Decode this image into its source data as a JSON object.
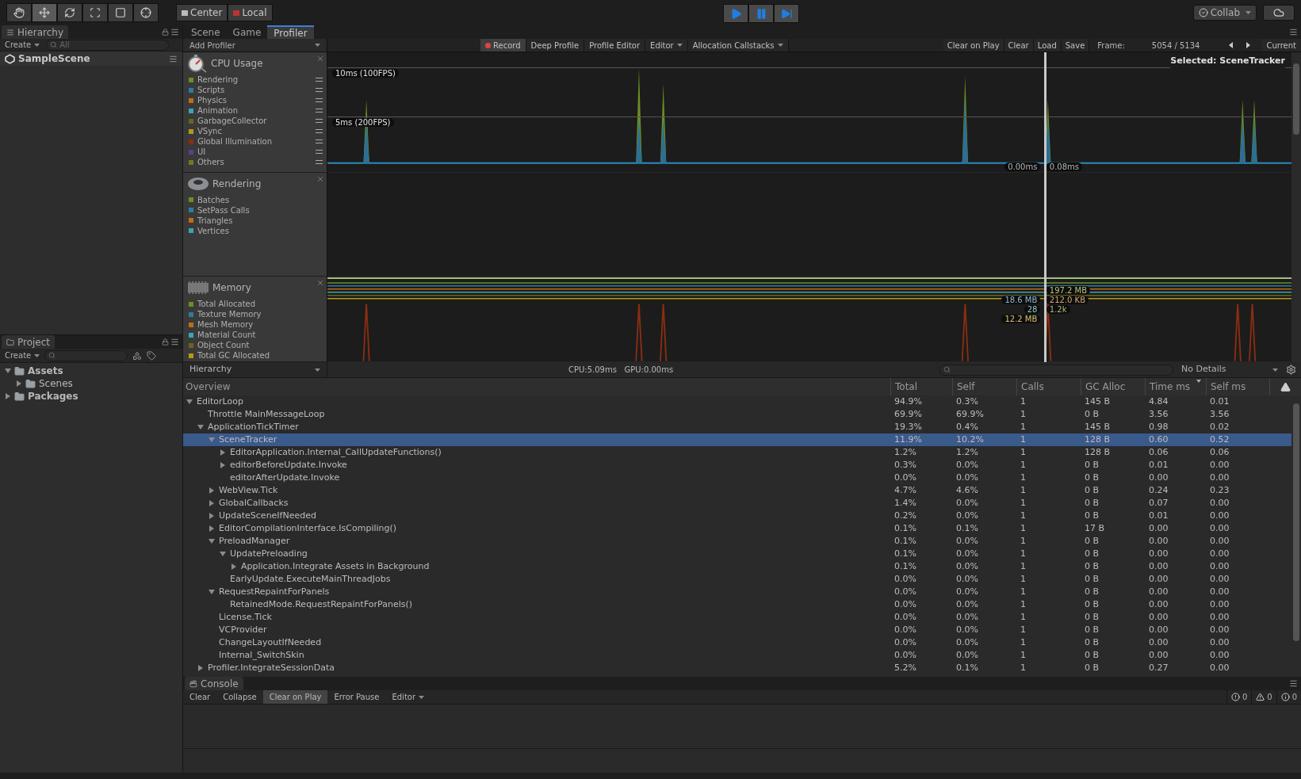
{
  "toolbar": {
    "tools": [
      {
        "kind": "hand",
        "selected": false
      },
      {
        "kind": "move",
        "selected": true
      },
      {
        "kind": "rotate",
        "selected": false
      },
      {
        "kind": "scale",
        "selected": false
      },
      {
        "kind": "rect",
        "selected": false
      },
      {
        "kind": "transform",
        "selected": false
      }
    ],
    "pivot": [
      "Center",
      "Local"
    ],
    "play": [
      {
        "kind": "play"
      },
      {
        "kind": "pause"
      },
      {
        "kind": "step"
      }
    ],
    "collab": "Collab"
  },
  "hierarchy": {
    "tab": "Hierarchy",
    "create": "Create",
    "search_placeholder": "All",
    "scene": "SampleScene"
  },
  "project": {
    "tab": "Project",
    "create": "Create",
    "tree": [
      {
        "name": "Assets",
        "kind": "branch",
        "expanded": true,
        "children": [
          {
            "name": "Scenes",
            "kind": "branch",
            "expanded": false
          }
        ]
      },
      {
        "name": "Packages",
        "kind": "branch",
        "expanded": false
      }
    ]
  },
  "tabs": [
    {
      "label": "Scene",
      "selected": false
    },
    {
      "label": "Game",
      "selected": false
    },
    {
      "label": "Profiler",
      "selected": true
    }
  ],
  "profiler_toolbar": {
    "add_profiler": "Add Profiler",
    "buttons": [
      {
        "label": "Record",
        "kind": "toggle",
        "selected": true
      },
      {
        "label": "Deep Profile",
        "kind": "toggle",
        "selected": false
      },
      {
        "label": "Profile Editor",
        "kind": "toggle",
        "selected": false
      },
      {
        "label": "Editor",
        "kind": "dropdown",
        "selected": false
      },
      {
        "label": "Allocation Callstacks",
        "kind": "dropdown",
        "selected": false
      }
    ],
    "right_buttons": [
      {
        "label": "Clear on Play",
        "selected": false
      },
      {
        "label": "Clear",
        "selected": false
      },
      {
        "label": "Load",
        "selected": false
      },
      {
        "label": "Save",
        "selected": false
      }
    ],
    "frame_label": "Frame:",
    "frame": "5054 / 5134",
    "current": "Current"
  },
  "modules": [
    {
      "kind": "cpu",
      "title": "CPU Usage",
      "legend": [
        {
          "name": "Rendering",
          "color": "#6b8e23"
        },
        {
          "name": "Scripts",
          "color": "#2b7ba3"
        },
        {
          "name": "Physics",
          "color": "#c36b12"
        },
        {
          "name": "Animation",
          "color": "#3aa6b1"
        },
        {
          "name": "GarbageCollector",
          "color": "#66661f"
        },
        {
          "name": "VSync",
          "color": "#b59a12"
        },
        {
          "name": "Global Illumination",
          "color": "#8a2e12"
        },
        {
          "name": "UI",
          "color": "#5a3f8f"
        },
        {
          "name": "Others",
          "color": "#76761f"
        }
      ],
      "grid": [
        "10ms (100FPS)",
        "5ms (200FPS)"
      ],
      "selected_label": "Selected: SceneTracker",
      "readings": [
        {
          "text": "0.00ms",
          "color": "#b4b4b4"
        },
        {
          "text": "0.08ms",
          "color": "#b4b4b4"
        }
      ]
    },
    {
      "kind": "rendering",
      "title": "Rendering",
      "legend": [
        {
          "name": "Batches",
          "color": "#6b8e23"
        },
        {
          "name": "SetPass Calls",
          "color": "#2b7ba3"
        },
        {
          "name": "Triangles",
          "color": "#c36b12"
        },
        {
          "name": "Vertices",
          "color": "#3aa6b1"
        }
      ]
    },
    {
      "kind": "memory",
      "title": "Memory",
      "legend": [
        {
          "name": "Total Allocated",
          "color": "#6b8e23"
        },
        {
          "name": "Texture Memory",
          "color": "#2b7ba3"
        },
        {
          "name": "Mesh Memory",
          "color": "#c36b12"
        },
        {
          "name": "Material Count",
          "color": "#3aa6b1"
        },
        {
          "name": "Object Count",
          "color": "#66661f"
        },
        {
          "name": "Total GC Allocated",
          "color": "#b59a12"
        }
      ],
      "readings": [
        {
          "text": "197.2 MB",
          "color": "#b9c27a"
        },
        {
          "text": "18.6 MB",
          "color": "#8fb8d0"
        },
        {
          "text": "212.0 KB",
          "color": "#d8a870"
        },
        {
          "text": "28",
          "color": "#8fc6cc"
        },
        {
          "text": "1.2k",
          "color": "#b4b47a"
        },
        {
          "text": "12.2 MB",
          "color": "#d8c070"
        }
      ]
    }
  ],
  "details_bar": {
    "view": "Hierarchy",
    "timing": "CPU:5.09ms   GPU:0.00ms",
    "details": "No Details"
  },
  "table": {
    "tree_column": "Overview",
    "columns": [
      {
        "label": "Total",
        "sorted": false
      },
      {
        "label": "Self",
        "sorted": false
      },
      {
        "label": "Calls",
        "sorted": false
      },
      {
        "label": "GC Alloc",
        "sorted": false
      },
      {
        "label": "Time ms",
        "sorted": true
      },
      {
        "label": "Self ms",
        "sorted": false
      }
    ],
    "rows": [
      {
        "name": "EditorLoop",
        "kind": "branch",
        "expanded": true,
        "selected": false,
        "cells": [
          "94.9%",
          "0.3%",
          "1",
          "145 B",
          "4.84",
          "0.01"
        ],
        "children": [
          {
            "name": "Throttle MainMessageLoop",
            "kind": "leaf",
            "selected": false,
            "cells": [
              "69.9%",
              "69.9%",
              "1",
              "0 B",
              "3.56",
              "3.56"
            ]
          },
          {
            "name": "ApplicationTickTimer",
            "kind": "branch",
            "expanded": true,
            "selected": false,
            "cells": [
              "19.3%",
              "0.4%",
              "1",
              "145 B",
              "0.98",
              "0.02"
            ],
            "children": [
              {
                "name": "SceneTracker",
                "kind": "branch",
                "expanded": true,
                "selected": true,
                "cells": [
                  "11.9%",
                  "10.2%",
                  "1",
                  "128 B",
                  "0.60",
                  "0.52"
                ],
                "children": [
                  {
                    "name": "EditorApplication.Internal_CallUpdateFunctions()",
                    "kind": "branch",
                    "expanded": false,
                    "selected": false,
                    "cells": [
                      "1.2%",
                      "1.2%",
                      "1",
                      "128 B",
                      "0.06",
                      "0.06"
                    ]
                  },
                  {
                    "name": "editorBeforeUpdate.Invoke",
                    "kind": "branch",
                    "expanded": false,
                    "selected": false,
                    "cells": [
                      "0.3%",
                      "0.0%",
                      "1",
                      "0 B",
                      "0.01",
                      "0.00"
                    ]
                  },
                  {
                    "name": "editorAfterUpdate.Invoke",
                    "kind": "leaf",
                    "selected": false,
                    "cells": [
                      "0.0%",
                      "0.0%",
                      "1",
                      "0 B",
                      "0.00",
                      "0.00"
                    ]
                  }
                ]
              },
              {
                "name": "WebView.Tick",
                "kind": "branch",
                "expanded": false,
                "selected": false,
                "cells": [
                  "4.7%",
                  "4.6%",
                  "1",
                  "0 B",
                  "0.24",
                  "0.23"
                ]
              },
              {
                "name": "GlobalCallbacks",
                "kind": "branch",
                "expanded": false,
                "selected": false,
                "cells": [
                  "1.4%",
                  "0.0%",
                  "1",
                  "0 B",
                  "0.07",
                  "0.00"
                ]
              },
              {
                "name": "UpdateSceneIfNeeded",
                "kind": "branch",
                "expanded": false,
                "selected": false,
                "cells": [
                  "0.2%",
                  "0.0%",
                  "1",
                  "0 B",
                  "0.01",
                  "0.00"
                ]
              },
              {
                "name": "EditorCompilationInterface.IsCompiling()",
                "kind": "branch",
                "expanded": false,
                "selected": false,
                "cells": [
                  "0.1%",
                  "0.1%",
                  "1",
                  "17 B",
                  "0.00",
                  "0.00"
                ]
              },
              {
                "name": "PreloadManager",
                "kind": "branch",
                "expanded": true,
                "selected": false,
                "cells": [
                  "0.1%",
                  "0.0%",
                  "1",
                  "0 B",
                  "0.00",
                  "0.00"
                ],
                "children": [
                  {
                    "name": "UpdatePreloading",
                    "kind": "branch",
                    "expanded": true,
                    "selected": false,
                    "cells": [
                      "0.1%",
                      "0.0%",
                      "1",
                      "0 B",
                      "0.00",
                      "0.00"
                    ],
                    "children": [
                      {
                        "name": "Application.Integrate Assets in Background",
                        "kind": "branch",
                        "expanded": false,
                        "selected": false,
                        "cells": [
                          "0.1%",
                          "0.0%",
                          "1",
                          "0 B",
                          "0.00",
                          "0.00"
                        ]
                      }
                    ]
                  },
                  {
                    "name": "EarlyUpdate.ExecuteMainThreadJobs",
                    "kind": "leaf",
                    "selected": false,
                    "cells": [
                      "0.0%",
                      "0.0%",
                      "1",
                      "0 B",
                      "0.00",
                      "0.00"
                    ]
                  }
                ]
              },
              {
                "name": "RequestRepaintForPanels",
                "kind": "branch",
                "expanded": true,
                "selected": false,
                "cells": [
                  "0.0%",
                  "0.0%",
                  "1",
                  "0 B",
                  "0.00",
                  "0.00"
                ],
                "children": [
                  {
                    "name": "RetainedMode.RequestRepaintForPanels()",
                    "kind": "leaf",
                    "selected": false,
                    "cells": [
                      "0.0%",
                      "0.0%",
                      "1",
                      "0 B",
                      "0.00",
                      "0.00"
                    ]
                  }
                ]
              },
              {
                "name": "License.Tick",
                "kind": "leaf",
                "selected": false,
                "cells": [
                  "0.0%",
                  "0.0%",
                  "1",
                  "0 B",
                  "0.00",
                  "0.00"
                ]
              },
              {
                "name": "VCProvider",
                "kind": "leaf",
                "selected": false,
                "cells": [
                  "0.0%",
                  "0.0%",
                  "1",
                  "0 B",
                  "0.00",
                  "0.00"
                ]
              },
              {
                "name": "ChangeLayoutIfNeeded",
                "kind": "leaf",
                "selected": false,
                "cells": [
                  "0.0%",
                  "0.0%",
                  "1",
                  "0 B",
                  "0.00",
                  "0.00"
                ]
              },
              {
                "name": "Internal_SwitchSkin",
                "kind": "leaf",
                "selected": false,
                "cells": [
                  "0.0%",
                  "0.0%",
                  "1",
                  "0 B",
                  "0.00",
                  "0.00"
                ]
              }
            ]
          },
          {
            "name": "Profiler.IntegrateSessionData",
            "kind": "branch",
            "expanded": false,
            "selected": false,
            "cells": [
              "5.2%",
              "0.1%",
              "1",
              "0 B",
              "0.27",
              "0.00"
            ]
          }
        ]
      }
    ]
  },
  "console": {
    "tab": "Console",
    "buttons": [
      {
        "label": "Clear",
        "kind": "button",
        "selected": false
      },
      {
        "label": "Collapse",
        "kind": "toggle",
        "selected": false
      },
      {
        "label": "Clear on Play",
        "kind": "toggle",
        "selected": true
      },
      {
        "label": "Error Pause",
        "kind": "toggle",
        "selected": false
      },
      {
        "label": "Editor",
        "kind": "dropdown",
        "selected": false
      }
    ],
    "counts": [
      {
        "kind": "error",
        "count": "0"
      },
      {
        "kind": "warning",
        "count": "0"
      },
      {
        "kind": "info",
        "count": "0"
      }
    ]
  }
}
